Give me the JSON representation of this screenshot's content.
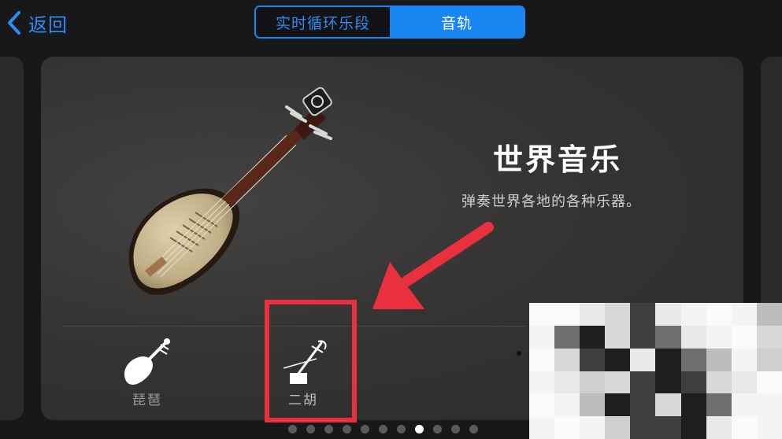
{
  "nav": {
    "back_label": "返回"
  },
  "segmented": {
    "items": [
      {
        "label": "实时循环乐段",
        "selected": false
      },
      {
        "label": "音轨",
        "selected": true
      }
    ]
  },
  "card": {
    "title": "世界音乐",
    "subtitle": "弹奏世界各地的各种乐器。"
  },
  "instruments": [
    {
      "label": "琵琶",
      "icon": "pipa-icon"
    },
    {
      "label": "二胡",
      "icon": "erhu-icon"
    }
  ],
  "pagination": {
    "total": 11,
    "current_index": 7
  },
  "colors": {
    "accent": "#1a86f2",
    "annotation": "#e8303f",
    "background": "#18181a"
  }
}
